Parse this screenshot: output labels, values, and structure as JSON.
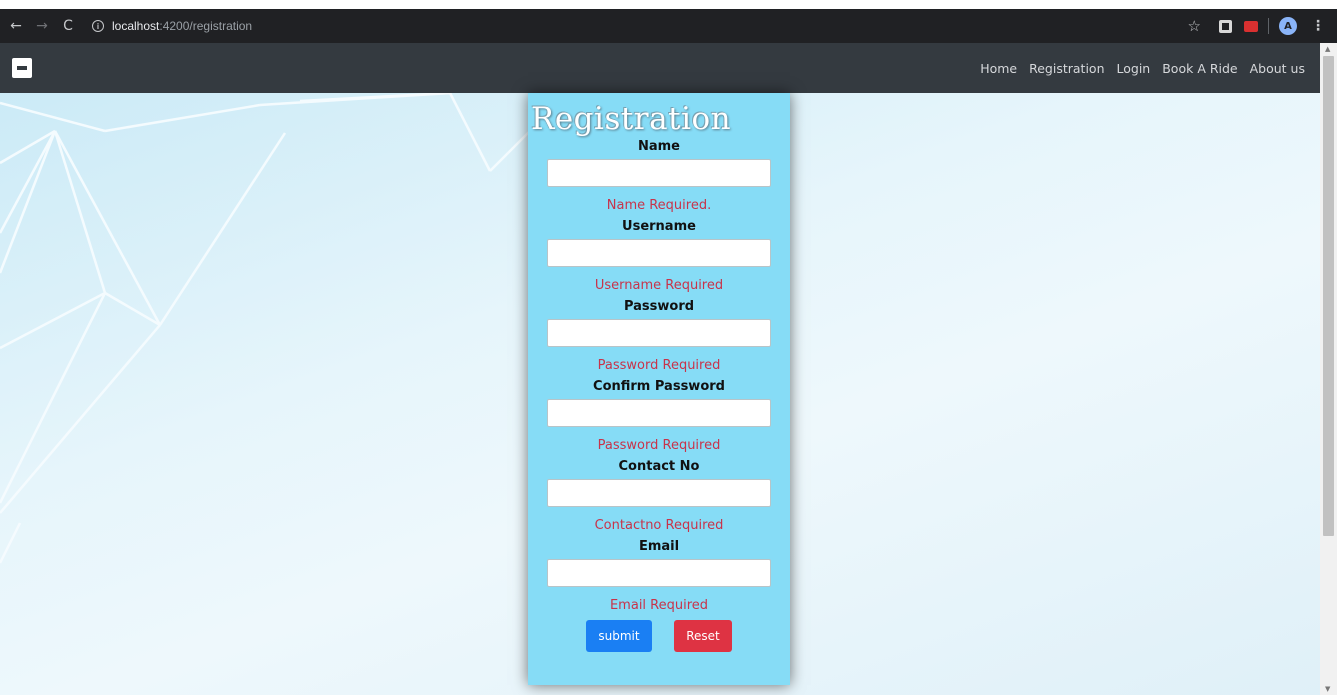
{
  "browser": {
    "url_host": "localhost",
    "url_path": ":4200/registration"
  },
  "navbar": {
    "links": [
      "Home",
      "Registration",
      "Login",
      "Book A Ride",
      "About us"
    ]
  },
  "avatar_letter": "A",
  "form": {
    "title": "Registration",
    "fields": [
      {
        "label": "Name",
        "value": "",
        "error": "Name Required."
      },
      {
        "label": "Username",
        "value": "",
        "error": "Username Required"
      },
      {
        "label": "Password",
        "value": "",
        "error": "Password Required"
      },
      {
        "label": "Confirm Password",
        "value": "",
        "error": "Password Required"
      },
      {
        "label": "Contact No",
        "value": "",
        "error": "Contactno Required"
      },
      {
        "label": "Email",
        "value": "",
        "error": "Email Required"
      }
    ],
    "submit_label": "submit",
    "reset_label": "Reset"
  },
  "colors": {
    "navbar_bg": "#343a40",
    "card_bg": "#86dcf6",
    "error": "#c8334a",
    "submit": "#1a7ff3",
    "reset": "#de3343"
  }
}
